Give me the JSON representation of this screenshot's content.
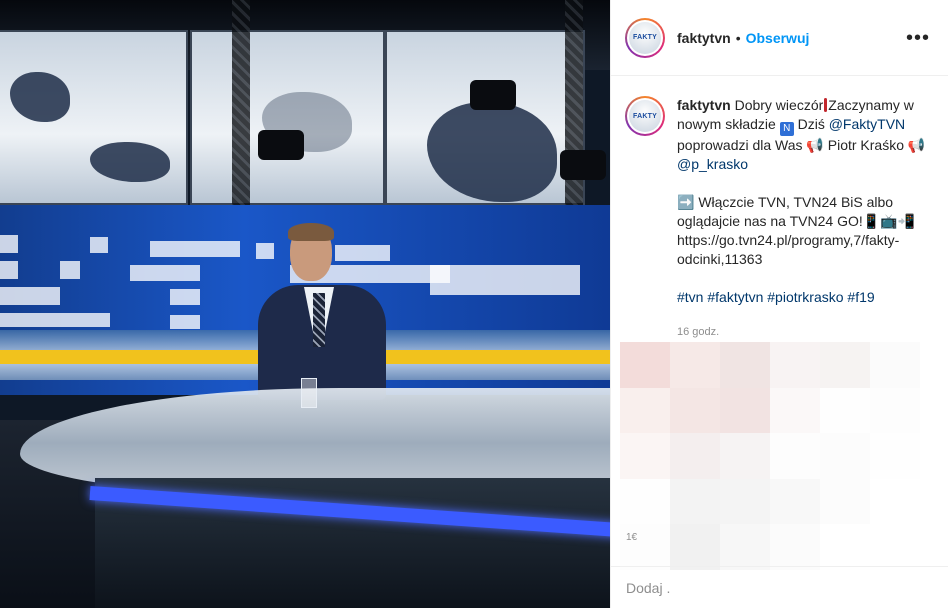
{
  "post": {
    "username": "faktytvn",
    "follow_label": "Obserwuj",
    "separator": "•",
    "more_icon": "more-horizontal-icon",
    "avatar_logo_text": "FAKTY"
  },
  "caption": {
    "username": "faktytvn",
    "line1_a": " Dobry wieczór",
    "line1_b": "Zaczynamy w nowym składzie ",
    "emoji_new": "🆕",
    "line1_c": " Dziś",
    "mention1": "@FaktyTVN",
    "line2": " poprowadzi dla Was 📢 Piotr Kraśko 📢 ",
    "mention2": "@p_krasko",
    "line3": "➡️ Włączcie TVN, TVN24 BiS albo oglądajcie nas na TVN24 GO!📱📺📲 https://go.tvn24.pl/programy,7/fakty-odcinki,11363",
    "hashtags": "#tvn #faktytvn #piotrkrasko #f19",
    "timestamp": "16 godz."
  },
  "comments": {
    "count_fragment": "1€",
    "input_placeholder": "Dodaj ."
  },
  "colors": {
    "follow": "#0095f6",
    "hashtag": "#00376b",
    "muted": "#8e8e8e"
  }
}
